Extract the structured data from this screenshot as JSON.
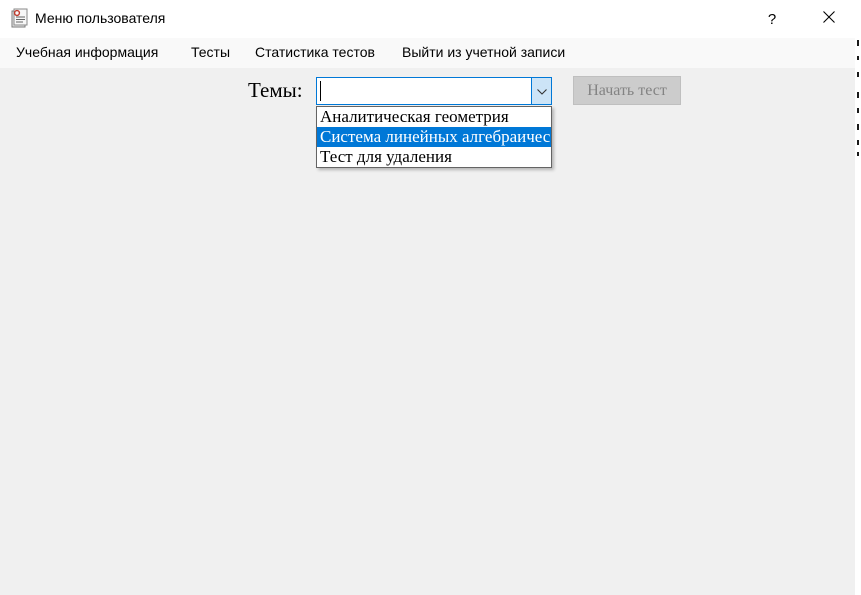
{
  "window": {
    "title": "Меню пользователя",
    "help_label": "?"
  },
  "menu": {
    "items": [
      {
        "label": "Учебная информация"
      },
      {
        "label": "Тесты"
      },
      {
        "label": "Статистика тестов"
      },
      {
        "label": "Выйти из учетной записи"
      }
    ]
  },
  "topics": {
    "label": "Темы:",
    "current_value": "",
    "options": [
      {
        "label": "Аналитическая геометрия",
        "selected": false
      },
      {
        "label": "Система линейных алгебраичес",
        "selected": true
      },
      {
        "label": "Тест для удаления",
        "selected": false
      }
    ]
  },
  "start_button": {
    "label": "Начать тест",
    "enabled": false
  },
  "colors": {
    "accent": "#0078d7",
    "window_bg": "#f0f0f0",
    "button_disabled_bg": "#cccccc",
    "button_disabled_text": "#838383"
  },
  "icons": {
    "app": "app-document-icon",
    "close": "close-icon",
    "dropdown": "chevron-down-icon"
  }
}
